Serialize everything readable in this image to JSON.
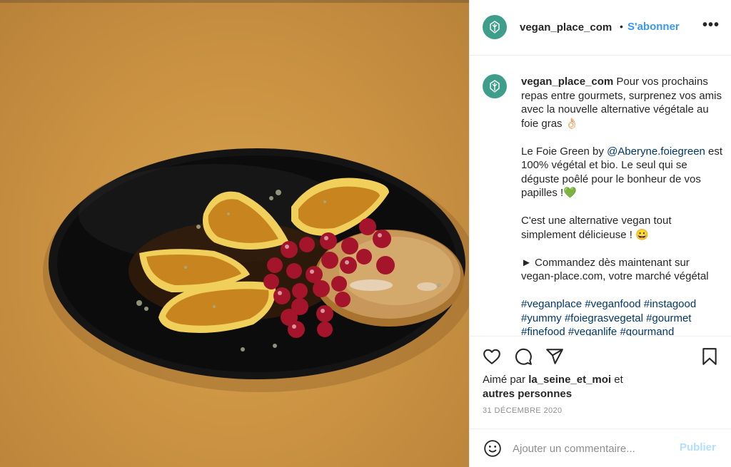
{
  "post": {
    "username": "vegan_place_com",
    "separator": "•",
    "follow_label": "S'abonner",
    "more_label": "•••"
  },
  "caption": {
    "username": "vegan_place_com",
    "intro": "Pour vos prochains repas entre gourmets, surprenez vos amis avec la nouvelle alternative végétale au foie gras 👌🏻",
    "p2_before": "Le Foie Green by ",
    "p2_mention": "@Aberyne.foiegreen",
    "p2_after": " est 100% végétal et bio. Le seul qui se déguste poêlé pour le bonheur de vos papilles !💚",
    "p3": "C'est une alternative vegan tout simplement délicieuse ! 😀",
    "p4": "► Commandez dès maintenant sur vegan-place.com, votre marché végétal",
    "hashtags": "#veganplace #veganfood #instagood #yummy #foiegrasvegetal #gourmet #finefood #veganlife #gourmand"
  },
  "likes": {
    "prefix": "Aimé par ",
    "user": "la_seine_et_moi",
    "middle": " et",
    "others": "autres personnes"
  },
  "date": "31 DÉCEMBRE 2020",
  "comment": {
    "placeholder": "Ajouter un commentaire...",
    "publish_label": "Publier"
  },
  "icons": {
    "like": "heart-icon",
    "comment": "comment-icon",
    "share": "share-icon",
    "save": "bookmark-icon",
    "emoji": "emoji-icon",
    "avatar_logo": "leaf-icon"
  },
  "colors": {
    "accent": "#3897f0",
    "publish_disabled": "#b2dffc",
    "avatar_bg": "#3f9d8c",
    "mention": "#00376b",
    "photo_background": "#c99141"
  }
}
